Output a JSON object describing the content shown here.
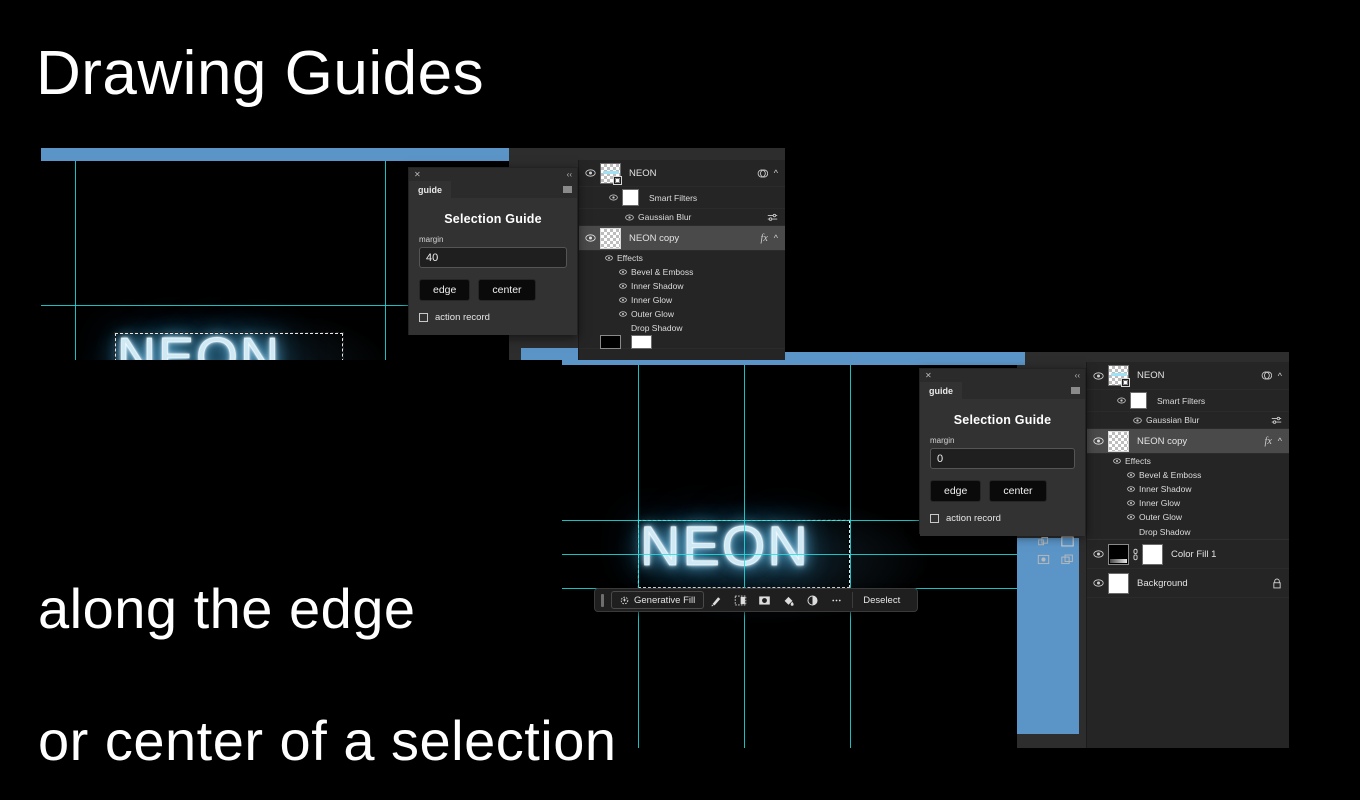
{
  "slide": {
    "title": "Drawing Guides",
    "caption_line1": "along the edge",
    "caption_line2": "or center of a selection",
    "bg_color": "#000000",
    "text_color": "#ffffff"
  },
  "colors": {
    "guide_cyan": "#1fe0e0",
    "band_blue": "#5b95c8",
    "panel_bg": "#323232",
    "layers_bg": "#252525",
    "selected_row": "#4a4a4a"
  },
  "canvas": {
    "neon_word": "NEON"
  },
  "contextual_taskbar": {
    "generative_fill": "Generative Fill",
    "deselect": "Deselect",
    "icons": [
      "grip-handle-icon",
      "generative-fill-icon",
      "select-subject-icon",
      "select-and-mask-icon",
      "invert-selection-icon",
      "fill-selection-icon",
      "adjustment-layer-icon",
      "more-options-icon"
    ]
  },
  "guide_panel_top": {
    "tab_label": "guide",
    "heading": "Selection Guide",
    "margin_label": "margin",
    "margin_value": "40",
    "button_edge": "edge",
    "button_center": "center",
    "checkbox_label": "action record",
    "checkbox_checked": false,
    "close_icon": "close-icon",
    "collapse_icon": "collapse-icon",
    "menu_icon": "panel-menu-icon"
  },
  "guide_panel_bottom": {
    "tab_label": "guide",
    "heading": "Selection Guide",
    "margin_label": "margin",
    "margin_value": "0",
    "button_edge": "edge",
    "button_center": "center",
    "checkbox_label": "action record",
    "checkbox_checked": false,
    "close_icon": "close-icon",
    "collapse_icon": "collapse-icon",
    "menu_icon": "panel-menu-icon"
  },
  "layers_panel_top": {
    "rows": [
      {
        "type": "layer",
        "name": "NEON",
        "thumb": "neon-smart-object",
        "right": "smart-object-icon",
        "chevron": "^",
        "selected": false
      },
      {
        "type": "sub",
        "name": "Smart Filters",
        "indent": 2,
        "thumb": "white-mask"
      },
      {
        "type": "sub",
        "name": "Gaussian Blur",
        "indent": 3,
        "right": "filter-settings-icon"
      },
      {
        "type": "layer",
        "name": "NEON copy",
        "thumb": "transparent",
        "right": "fx",
        "chevron": "^",
        "selected": true
      },
      {
        "type": "sub",
        "name": "Effects",
        "indent": 2
      },
      {
        "type": "sub",
        "name": "Bevel & Emboss",
        "indent": 3
      },
      {
        "type": "sub",
        "name": "Inner Shadow",
        "indent": 3
      },
      {
        "type": "sub",
        "name": "Inner Glow",
        "indent": 3
      },
      {
        "type": "sub",
        "name": "Outer Glow",
        "indent": 3
      },
      {
        "type": "sub",
        "name": "Drop Shadow",
        "indent": 3,
        "no_eye": true
      }
    ]
  },
  "layers_panel_bottom": {
    "rows": [
      {
        "type": "layer",
        "name": "NEON",
        "thumb": "neon-smart-object",
        "right": "smart-object-icon",
        "chevron": "^",
        "selected": false
      },
      {
        "type": "sub",
        "name": "Smart Filters",
        "indent": 2,
        "thumb": "white-mask"
      },
      {
        "type": "sub",
        "name": "Gaussian Blur",
        "indent": 3,
        "right": "filter-settings-icon"
      },
      {
        "type": "layer",
        "name": "NEON copy",
        "thumb": "transparent",
        "right": "fx",
        "chevron": "^",
        "selected": true
      },
      {
        "type": "sub",
        "name": "Effects",
        "indent": 2
      },
      {
        "type": "sub",
        "name": "Bevel & Emboss",
        "indent": 3
      },
      {
        "type": "sub",
        "name": "Inner Shadow",
        "indent": 3
      },
      {
        "type": "sub",
        "name": "Inner Glow",
        "indent": 3
      },
      {
        "type": "sub",
        "name": "Outer Glow",
        "indent": 3
      },
      {
        "type": "sub",
        "name": "Drop Shadow",
        "indent": 3,
        "no_eye": true
      },
      {
        "type": "layer",
        "name": "Color Fill 1",
        "thumb": "black-gradient",
        "link": "link-icon",
        "mask": "white-mask",
        "selected": false
      },
      {
        "type": "layer",
        "name": "Background",
        "thumb": "white",
        "right": "lock-icon",
        "selected": false
      }
    ]
  },
  "panel_footer_icons": [
    "link-layers-icon",
    "new-group-icon",
    "add-mask-icon",
    "new-layer-icon"
  ]
}
